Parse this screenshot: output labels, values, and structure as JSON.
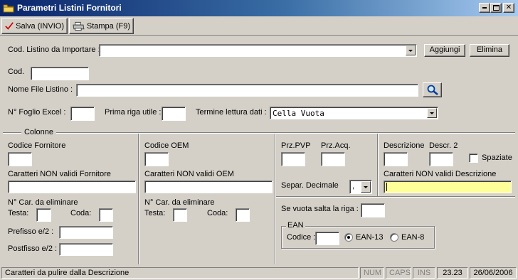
{
  "window": {
    "title": "Parametri Listini Fornitori",
    "icon": "folder-icon",
    "controls": [
      "minimize",
      "maximize",
      "close"
    ]
  },
  "toolbar": {
    "save_label": "Salva (INVIO)",
    "print_label": "Stampa (F9)"
  },
  "top": {
    "cod_listino_label": "Cod. Listino da Importare :",
    "cod_listino_value": "",
    "aggiungi_label": "Aggiungi",
    "elimina_label": "Elimina",
    "cod_label": "Cod.",
    "cod_value": "",
    "nome_file_label": "Nome File Listino :",
    "nome_file_value": "",
    "foglio_label": "N° Foglio Excel :",
    "foglio_value": "",
    "prima_riga_label": "Prima riga utile :",
    "prima_riga_value": "",
    "termine_label": "Termine lettura dati :",
    "termine_value": "Cella Vuota"
  },
  "colonne": {
    "legend": "Colonne",
    "fornitore": {
      "codice_label": "Codice Fornitore",
      "caratteri_label": "Caratteri NON validi Fornitore",
      "ncar_label": "N° Car. da eliminare",
      "testa_label": "Testa:",
      "coda_label": "Coda:",
      "prefisso_label": "Prefisso e/2 :",
      "postfisso_label": "Postfisso e/2 :"
    },
    "oem": {
      "codice_label": "Codice OEM",
      "caratteri_label": "Caratteri NON validi OEM",
      "ncar_label": "N° Car. da eliminare",
      "testa_label": "Testa:",
      "coda_label": "Coda:"
    },
    "prezzi": {
      "przpvp_label": "Prz.PVP",
      "przacq_label": "Prz.Acq.",
      "separ_label": "Separ. Decimale",
      "separ_value": ","
    },
    "descrizione": {
      "descr_label": "Descrizione",
      "descr2_label": "Descr. 2",
      "spaziate_label": "Spaziate",
      "spaziate_checked": false,
      "caratteri_label": "Caratteri NON validi Descrizione",
      "highlight_color": "#ffff99"
    },
    "salta": {
      "label": "Se vuota salta la riga :"
    },
    "ean": {
      "legend": "EAN",
      "codice_label": "Codice :",
      "ean13_label": "EAN-13",
      "ean8_label": "EAN-8",
      "selected": "EAN-13"
    }
  },
  "statusbar": {
    "message": "Caratteri da pulire dalla Descrizione",
    "num": "NUM",
    "caps": "CAPS",
    "ins": "INS",
    "time": "23.23",
    "date": "26/06/2006"
  }
}
